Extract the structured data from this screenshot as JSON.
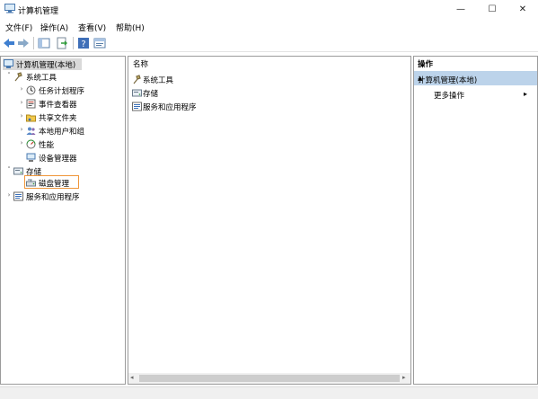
{
  "window": {
    "title": "计算机管理",
    "controls": {
      "minimize": "—",
      "maximize": "☐",
      "close": "✕"
    }
  },
  "menu": [
    {
      "label": "文件(F)"
    },
    {
      "label": "操作(A)"
    },
    {
      "label": "查看(V)"
    },
    {
      "label": "帮助(H)"
    }
  ],
  "tree": {
    "root": "计算机管理(本地)",
    "items": [
      {
        "label": "系统工具",
        "arrow": "˅"
      },
      {
        "label": "任务计划程序",
        "arrow": "›"
      },
      {
        "label": "事件查看器",
        "arrow": "›"
      },
      {
        "label": "共享文件夹",
        "arrow": "›"
      },
      {
        "label": "本地用户和组",
        "arrow": "›"
      },
      {
        "label": "性能",
        "arrow": "›"
      },
      {
        "label": "设备管理器",
        "arrow": ""
      },
      {
        "label": "存储",
        "arrow": "˅"
      },
      {
        "label": "磁盘管理",
        "arrow": ""
      },
      {
        "label": "服务和应用程序",
        "arrow": "›"
      }
    ]
  },
  "list": {
    "header": "名称",
    "rows": [
      {
        "label": "系统工具"
      },
      {
        "label": "存储"
      },
      {
        "label": "服务和应用程序"
      }
    ]
  },
  "actions": {
    "title": "操作",
    "section": "计算机管理(本地)",
    "section_caret": "▲",
    "more": "更多操作",
    "more_arrow": "▸"
  },
  "scroll": {
    "left": "◂",
    "right": "▸"
  },
  "colors": {
    "selection": "#bcd3ea",
    "highlight_border": "#f0963a",
    "tree_selected": "#d9d9d9"
  }
}
